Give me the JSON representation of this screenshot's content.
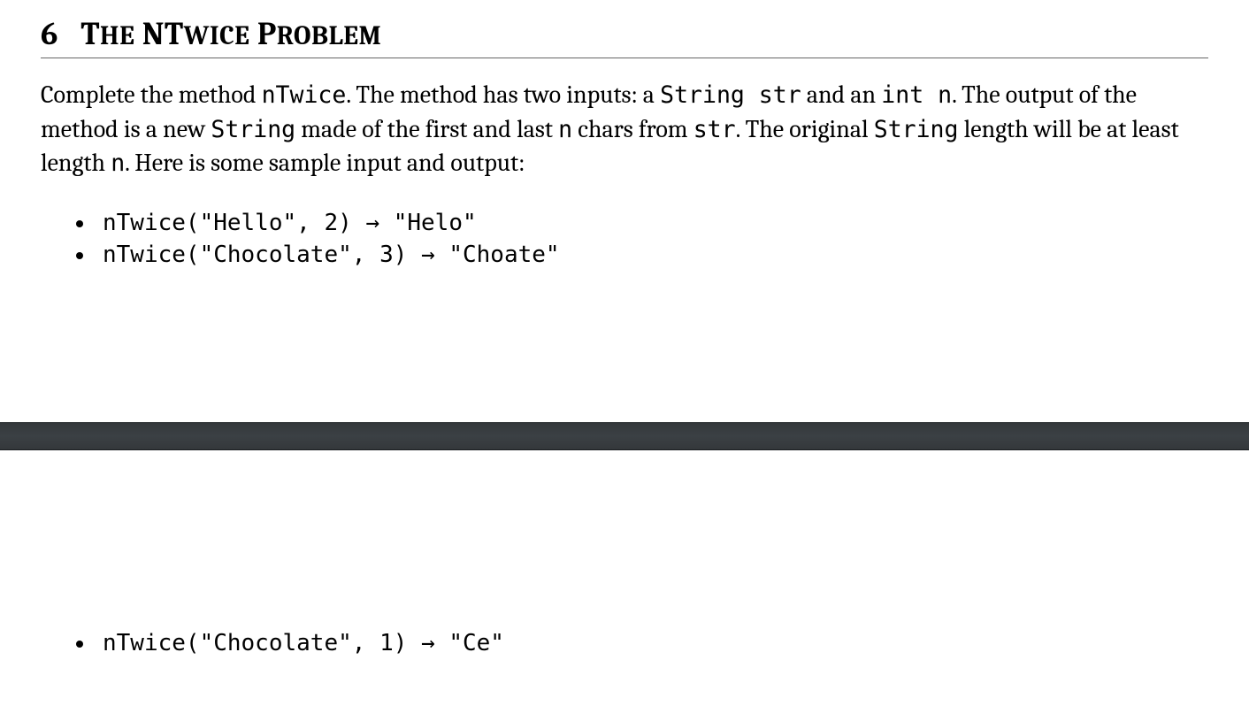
{
  "section": {
    "number": "6",
    "title_words": [
      {
        "first": "T",
        "rest": "HE"
      },
      {
        "first": "NT",
        "rest": "WICE"
      },
      {
        "first": "P",
        "rest": "ROBLEM"
      }
    ]
  },
  "paragraph": {
    "t1": "Complete the method ",
    "c1": "nTwice",
    "t2": ". The method has two inputs: a ",
    "c2": "String str",
    "t3": " and an ",
    "c3": "int n",
    "t4": ". The output of the method is a new ",
    "c4": "String",
    "t5": " made of the first and last ",
    "c5": "n",
    "t6": " chars from ",
    "c6": "str",
    "t7": ". The original ",
    "c7": "String",
    "t8": " length will be at least length ",
    "c8": "n",
    "t9": ". Here is some sample input and output:"
  },
  "samples_page1": [
    "nTwice(\"Hello\", 2) → \"Helo\"",
    "nTwice(\"Chocolate\", 3) → \"Choate\""
  ],
  "samples_page2": [
    "nTwice(\"Chocolate\", 1) → \"Ce\""
  ]
}
